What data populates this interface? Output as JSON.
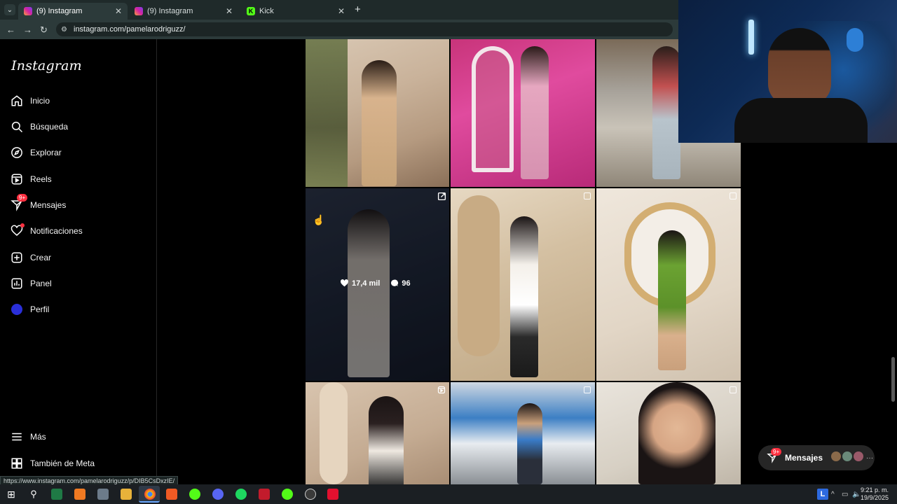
{
  "browser": {
    "tabs": [
      {
        "title": "(9) Instagram",
        "active": true
      },
      {
        "title": "(9) Instagram",
        "active": false
      },
      {
        "title": "Kick",
        "active": false
      }
    ],
    "url": "instagram.com/pamelarodriguzz/",
    "status_url": "https://www.instagram.com/pamelarodriguzz/p/DIB5CsDxzIE/"
  },
  "sidebar": {
    "logo": "Instagram",
    "items": [
      {
        "label": "Inicio",
        "icon": "home-icon"
      },
      {
        "label": "Búsqueda",
        "icon": "search-icon"
      },
      {
        "label": "Explorar",
        "icon": "compass-icon"
      },
      {
        "label": "Reels",
        "icon": "reels-icon"
      },
      {
        "label": "Mensajes",
        "icon": "messenger-icon",
        "badge": "9+"
      },
      {
        "label": "Notificaciones",
        "icon": "heart-icon"
      },
      {
        "label": "Crear",
        "icon": "plus-square-icon"
      },
      {
        "label": "Panel",
        "icon": "chart-icon"
      },
      {
        "label": "Perfil",
        "icon": "avatar-icon"
      }
    ],
    "bottom_items": [
      {
        "label": "Más",
        "icon": "menu-icon"
      },
      {
        "label": "También de Meta",
        "icon": "meta-icon"
      }
    ]
  },
  "grid": {
    "hover_post": {
      "likes": "17,4 mil",
      "comments": "96"
    }
  },
  "messages_pill": {
    "label": "Mensajes",
    "badge": "9+"
  },
  "taskbar": {
    "tray_letter": "L",
    "time": "9:21 p. m.",
    "date": "19/9/2025"
  },
  "colors": {
    "accent": "#ff3040",
    "sidebar_bg": "#000000",
    "chrome_bg": "#2c3a3a"
  }
}
